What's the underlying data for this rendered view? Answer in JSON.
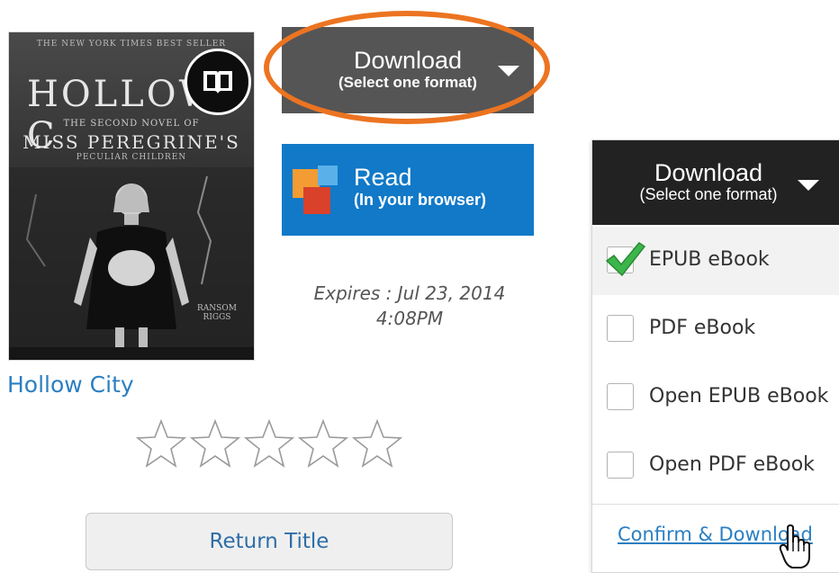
{
  "book": {
    "title": "Hollow City",
    "cover": {
      "top_line": "THE NEW YORK TIMES BEST SELLER",
      "title": "HOLLOW C",
      "subtitle": "THE SECOND NOVEL OF",
      "series": "MISS PEREGRINE'S",
      "series2": "PECULIAR CHILDREN",
      "author": "RANSOM RIGGS"
    },
    "badge_icon": "open-book-icon",
    "rating": {
      "value": 0,
      "max": 5
    }
  },
  "download": {
    "label": "Download",
    "sublabel": "(Select one format)",
    "caret_icon": "caret-down-icon",
    "highlight_color": "#ec7421"
  },
  "read": {
    "label": "Read",
    "sublabel": "(In your browser)",
    "icon": "read-in-browser-icon",
    "color": "#1179c8"
  },
  "expires": {
    "label": "Expires :",
    "date": "Jul 23, 2014",
    "time": "4:08PM"
  },
  "return_button": {
    "label": "Return Title"
  },
  "format_panel": {
    "header": {
      "label": "Download",
      "sublabel": "(Select one format)"
    },
    "options": [
      {
        "label": "EPUB eBook",
        "checked": true
      },
      {
        "label": "PDF eBook",
        "checked": false
      },
      {
        "label": "Open EPUB eBook",
        "checked": false
      },
      {
        "label": "Open PDF eBook",
        "checked": false
      }
    ],
    "confirm_label": "Confirm & Download",
    "check_color": "#3cb64a"
  }
}
